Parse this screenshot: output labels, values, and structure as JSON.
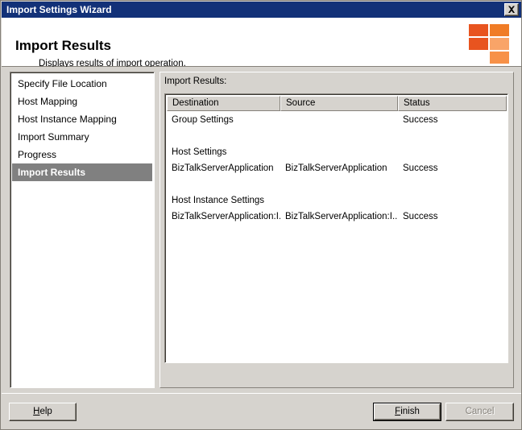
{
  "window": {
    "title": "Import Settings Wizard",
    "close_icon": "close-icon"
  },
  "header": {
    "title": "Import Results",
    "subtitle": "Displays results of import operation.",
    "logo_colors": [
      "#e8541f",
      "#f07c26",
      "#e8541f",
      "#f9a468",
      "#f79148"
    ]
  },
  "sidebar": {
    "items": [
      {
        "label": "Specify File Location",
        "selected": false
      },
      {
        "label": "Host Mapping",
        "selected": false
      },
      {
        "label": "Host Instance Mapping",
        "selected": false
      },
      {
        "label": "Import Summary",
        "selected": false
      },
      {
        "label": "Progress",
        "selected": false
      },
      {
        "label": "Import Results",
        "selected": true
      }
    ]
  },
  "main": {
    "list_label": "Import Results:",
    "columns": [
      "Destination",
      "Source",
      "Status"
    ],
    "rows": [
      {
        "destination": "Group Settings",
        "source": "",
        "status": "Success"
      },
      {
        "destination": "",
        "source": "",
        "status": ""
      },
      {
        "destination": "Host Settings",
        "source": "",
        "status": ""
      },
      {
        "destination": "BizTalkServerApplication",
        "source": "BizTalkServerApplication",
        "status": "Success"
      },
      {
        "destination": "",
        "source": "",
        "status": ""
      },
      {
        "destination": "Host Instance Settings",
        "source": "",
        "status": ""
      },
      {
        "destination": "BizTalkServerApplication:I...",
        "source": "BizTalkServerApplication:I...",
        "status": "Success"
      }
    ]
  },
  "footer": {
    "help_label_pre": "",
    "help_label_key": "H",
    "help_label_post": "elp",
    "finish_label_pre": "",
    "finish_label_key": "F",
    "finish_label_post": "inish",
    "cancel_label": "Cancel"
  }
}
